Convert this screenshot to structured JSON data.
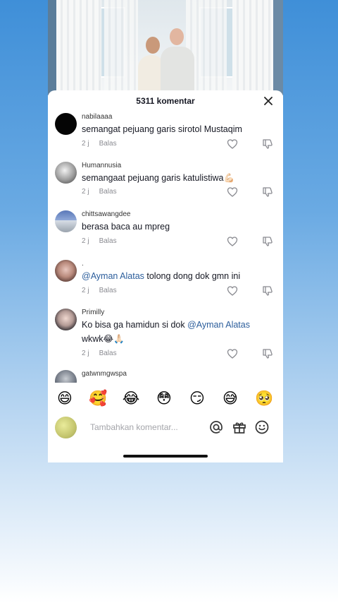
{
  "sheet": {
    "title": "5311 komentar"
  },
  "comments": [
    {
      "username": "nabilaaaa",
      "text": "semangat pejuang garis sirotol Mustaqim",
      "time": "2 j",
      "reply": "Balas"
    },
    {
      "username": "Humannusia",
      "text": "semangaat pejuang garis katulistiwa💪🏻",
      "time": "2 j",
      "reply": "Balas"
    },
    {
      "username": "chittsawangdee",
      "text": "berasa baca au mpreg",
      "time": "2 j",
      "reply": "Balas"
    },
    {
      "username": ".",
      "mention": "@Ayman Alatas",
      "text": " tolong dong dok gmn ini",
      "time": "2 j",
      "reply": "Balas"
    },
    {
      "username": "Primilly",
      "text_before": "Ko bisa ga hamidun si dok ",
      "mention": "@Ayman Alatas",
      "text_after": "wkwk😂🙏🏻",
      "time": "2 j",
      "reply": "Balas"
    },
    {
      "username": "gatwnmgwspa"
    }
  ],
  "emojis": [
    "😄",
    "🥰",
    "😂",
    "😳",
    "😏",
    "😅",
    "🥺"
  ],
  "input": {
    "placeholder": "Tambahkan komentar..."
  },
  "icons": {
    "close": "close-icon",
    "like": "heart-outline-icon",
    "dislike": "thumbs-down-icon",
    "mention": "at-icon",
    "gift": "gift-icon",
    "emoji": "smiley-icon"
  }
}
